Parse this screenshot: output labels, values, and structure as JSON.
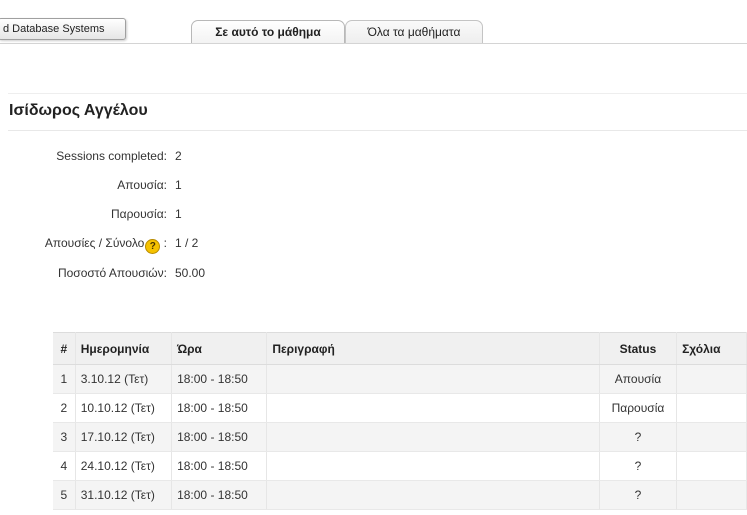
{
  "course_button": "d Database Systems",
  "tabs": [
    {
      "label": "Σε αυτό το μάθημα",
      "active": true
    },
    {
      "label": "Όλα τα μαθήματα",
      "active": false
    }
  ],
  "user_name": "Ισίδωρος Αγγέλου",
  "stats": [
    {
      "label": "Sessions completed:",
      "value": "2"
    },
    {
      "label": "Απουσία:",
      "value": "1"
    },
    {
      "label": "Παρουσία:",
      "value": "1"
    },
    {
      "label": "Απουσίες / Σύνολο",
      "suffix": " :",
      "value": "1 / 2",
      "help_icon": "help-icon"
    },
    {
      "label": "Ποσοστό Απουσιών:",
      "value": "50.00"
    }
  ],
  "help_glyph": "?",
  "table": {
    "headers": [
      "#",
      "Ημερομηνία",
      "Ώρα",
      "Περιγραφή",
      "Status",
      "Σχόλια"
    ],
    "rows": [
      {
        "num": "1",
        "date": "3.10.12 (Τετ)",
        "time": "18:00 - 18:50",
        "desc": "",
        "status": "Απουσία",
        "notes": ""
      },
      {
        "num": "2",
        "date": "10.10.12 (Τετ)",
        "time": "18:00 - 18:50",
        "desc": "",
        "status": "Παρουσία",
        "notes": ""
      },
      {
        "num": "3",
        "date": "17.10.12 (Τετ)",
        "time": "18:00 - 18:50",
        "desc": "",
        "status": "?",
        "notes": ""
      },
      {
        "num": "4",
        "date": "24.10.12 (Τετ)",
        "time": "18:00 - 18:50",
        "desc": "",
        "status": "?",
        "notes": ""
      },
      {
        "num": "5",
        "date": "31.10.12 (Τετ)",
        "time": "18:00 - 18:50",
        "desc": "",
        "status": "?",
        "notes": ""
      }
    ]
  }
}
